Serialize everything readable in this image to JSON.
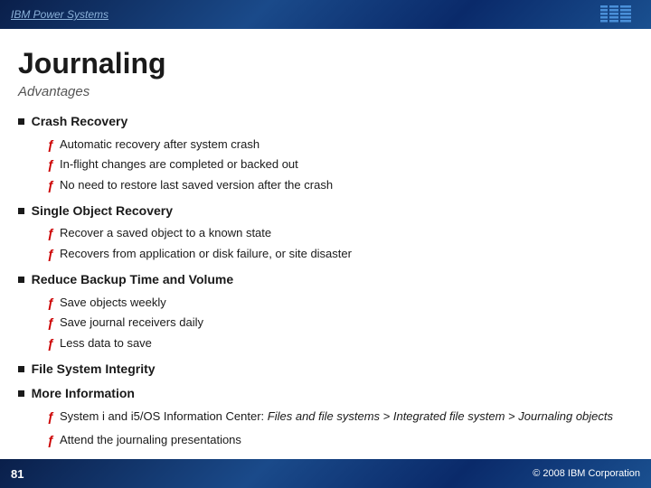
{
  "header": {
    "title": "IBM Power Systems"
  },
  "page": {
    "title": "Journaling",
    "subtitle": "Advantages"
  },
  "sections": [
    {
      "id": "crash-recovery",
      "title": "Crash Recovery",
      "items": [
        "Automatic recovery after system crash",
        "In-flight changes are completed or backed out",
        "No need to restore last saved version after the crash"
      ]
    },
    {
      "id": "single-object-recovery",
      "title": "Single Object Recovery",
      "items": [
        "Recover a saved object to a known state",
        "Recovers from application or disk failure, or site disaster"
      ]
    },
    {
      "id": "reduce-backup",
      "title": "Reduce Backup Time and Volume",
      "items": [
        "Save objects weekly",
        "Save journal receivers daily",
        "Less data to save"
      ]
    },
    {
      "id": "file-system",
      "title": "File System Integrity",
      "items": []
    },
    {
      "id": "more-info",
      "title": "More Information",
      "items": []
    }
  ],
  "more_info_items": [
    {
      "prefix": "System i and i5/OS Information Center: ",
      "italic": "Files and file systems > Integrated file system > Journaling objects",
      "suffix": ""
    },
    {
      "prefix": "Attend the journaling presentations",
      "italic": "",
      "suffix": ""
    }
  ],
  "footer": {
    "page_number": "81",
    "copyright": "© 2008 IBM Corporation"
  }
}
